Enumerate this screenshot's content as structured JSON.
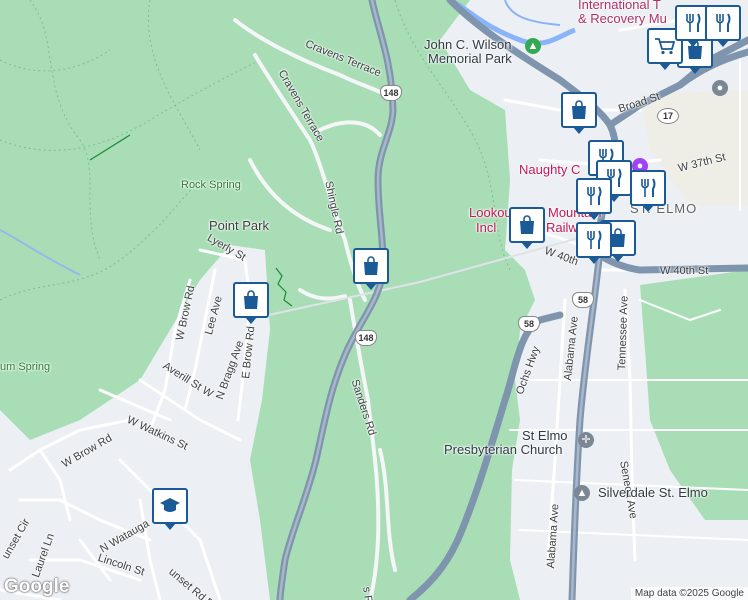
{
  "map": {
    "attribution": "Map data ©2025 Google",
    "logo": "Google",
    "colors": {
      "park": "#a8ddb5",
      "urban": "#eceff3",
      "water": "#8ab4f8",
      "highway": "#7f95ad",
      "marker": "#1a5a96"
    },
    "labels": {
      "museum": [
        "International T",
        "& Recovery Mu"
      ],
      "wilson_park": [
        "John C. Wilson",
        "Memorial Park"
      ],
      "cravens_terrace_1": "Cravens Terrace",
      "cravens_terrace_2": "Cravens Terrace",
      "broad_st": "Broad St",
      "w37th": "W 37th St",
      "naughty": "Naughty C",
      "rock_spring": "Rock Spring",
      "shingle_rd": "Shingle Rd",
      "point_park": "Point Park",
      "lookout": [
        "Lookou",
        "Incl"
      ],
      "lookout_mid1": "Mountain",
      "lookout_mid2": "Railway",
      "st_elmo_district": "ST. ELMO",
      "w40th_a": "W 40th",
      "w40th_b": "W 40th St",
      "lyerly": "Lyerly St",
      "w_brow_rd_top": "W Brow Rd",
      "lee_ave": "Lee Ave",
      "e_brow_rd": "E Brow Rd",
      "n_bragg": "N Bragg Ave",
      "averill": "Averill St W",
      "spring": "um Spring",
      "sanders": "Sanders Rd",
      "ochs": "Ochs Hwy",
      "alabama_top": "Alabama Ave",
      "tennessee": "Tennessee Ave",
      "w_watkins": "W Watkins St",
      "w_brow_rd": "W Brow Rd",
      "st_elmo_church": [
        "St Elmo",
        "Presbyterian Church"
      ],
      "seneca": "Seneca Ave",
      "silverdale": "Silverdale St. Elmo",
      "alabama_bottom": "Alabama Ave",
      "sunset_cir": "unset Cir",
      "laurel": "Laurel Ln",
      "n_watauga": "N Watauga",
      "lincoln": "Lincoln St",
      "sunset_rd": "unset Rd E",
      "sanders_bottom": "s Rd"
    },
    "shields": {
      "s148_top": "148",
      "s148_mid": "148",
      "s58_a": "58",
      "s58_b": "58",
      "s17": "17"
    },
    "markers": [
      {
        "name": "shopping",
        "icon": "shopping-bag-icon"
      },
      {
        "name": "restaurant",
        "icon": "fork-knife-icon"
      },
      {
        "name": "grocery",
        "icon": "cart-icon"
      },
      {
        "name": "school",
        "icon": "graduation-cap-icon"
      }
    ]
  }
}
